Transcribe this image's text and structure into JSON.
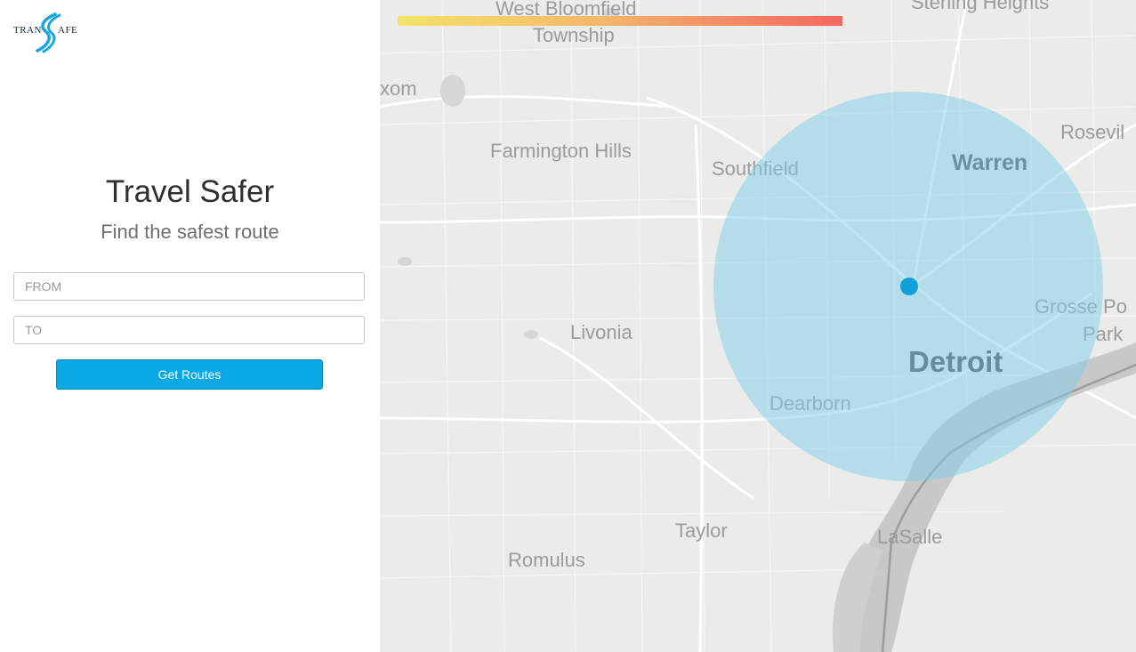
{
  "logo": {
    "text_left": "TRAN",
    "text_right": "AFE"
  },
  "sidebar": {
    "title": "Travel Safer",
    "subtitle": "Find the safest route",
    "from_placeholder": "FROM",
    "to_placeholder": "TO",
    "button_label": "Get Routes"
  },
  "colors": {
    "accent": "#0aa9e6",
    "radius_fill": "#7fcfe8",
    "location_dot": "#129fd9",
    "gradient": [
      "#f3e36c",
      "#f6b76b",
      "#f3685f"
    ]
  },
  "map": {
    "labels": [
      "West Bloomfield",
      "Township",
      "Sterling Heights",
      "xom",
      "Farmington Hills",
      "Southfield",
      "Warren",
      "Rosevil",
      "Grosse Po",
      "Park",
      "Livonia",
      "Detroit",
      "Dearborn",
      "Taylor",
      "LaSalle",
      "Romulus"
    ]
  }
}
